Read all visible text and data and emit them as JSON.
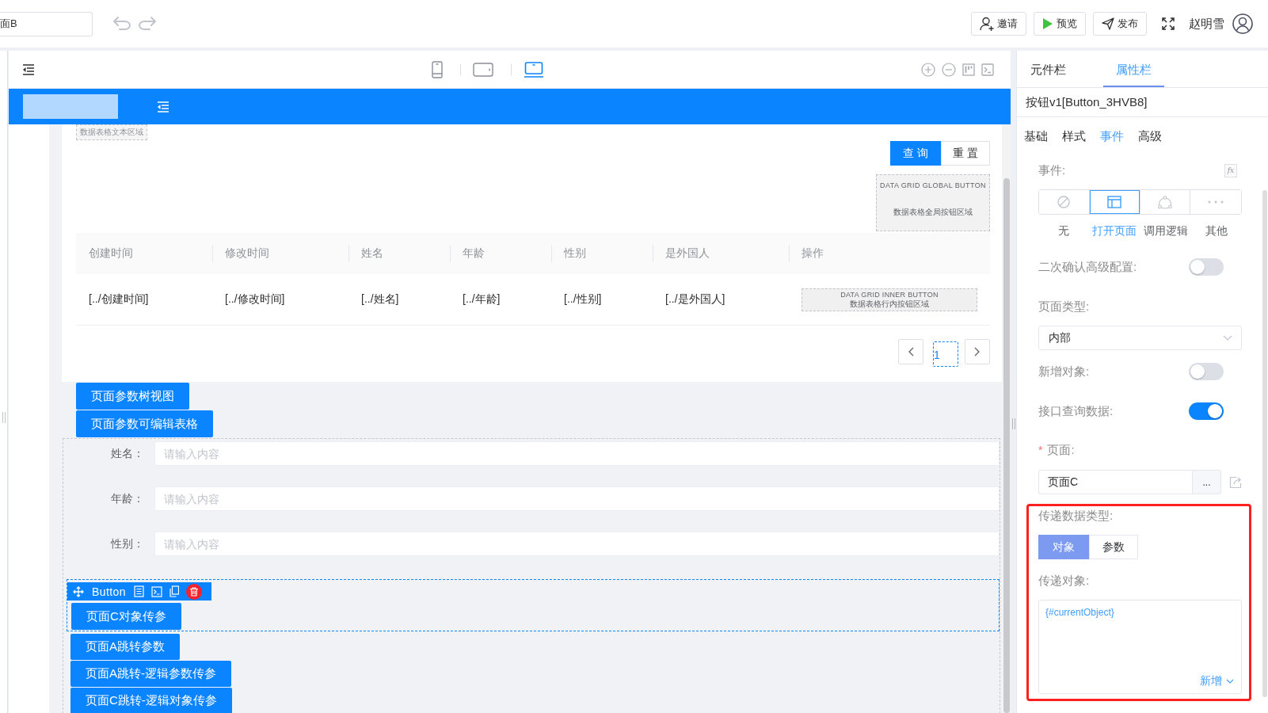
{
  "top_bar": {
    "page_name": "面B",
    "actions": [
      {
        "kind": "invite",
        "label": "邀请"
      },
      {
        "kind": "preview",
        "label": "预览"
      },
      {
        "kind": "publish",
        "label": "发布"
      }
    ],
    "user_name": "赵明雪"
  },
  "canvas": {
    "devices": [
      {
        "kind": "phone",
        "selected": false
      },
      {
        "kind": "tablet",
        "selected": false
      },
      {
        "kind": "laptop",
        "selected": true
      }
    ],
    "grid": {
      "text_area": "数据表格文本区域",
      "query_buttons": [
        {
          "label": "查 询",
          "primary": true
        },
        {
          "label": "重 置",
          "primary": false
        }
      ],
      "global_area": {
        "title": "DATA GRID GLOBAL BUTTON",
        "caption": "数据表格全局按钮区域"
      },
      "columns": [
        "创建时间",
        "修改时间",
        "姓名",
        "年龄",
        "性别",
        "是外国人",
        "操作"
      ],
      "rows": [
        {
          "cells": [
            "[../创建时间]",
            "[../修改时间]",
            "[../姓名]",
            "[../年龄]",
            "[../性别]",
            "[../是外国人]"
          ],
          "inner_area": {
            "title": "DATA GRID INNER BUTTON",
            "caption": "数据表格行内按钮区域"
          }
        }
      ],
      "pages": [
        {
          "label": "1",
          "selected": true
        }
      ]
    },
    "page_buttons": [
      "页面参数树视图",
      "页面参数可编辑表格"
    ],
    "form_fields": [
      {
        "label": "姓名：",
        "placeholder": "请输入内容"
      },
      {
        "label": "年龄：",
        "placeholder": "请输入内容"
      },
      {
        "label": "性别：",
        "placeholder": "请输入内容"
      }
    ],
    "selected_component": {
      "type_label": "Button",
      "label": "页面C对象传参"
    },
    "more_buttons": [
      "页面A跳转参数",
      "页面A跳转-逻辑参数传参",
      "页面C跳转-逻辑对象传参"
    ]
  },
  "panel": {
    "tabs": [
      {
        "label": "元件栏",
        "selected": false
      },
      {
        "label": "属性栏",
        "selected": true
      }
    ],
    "component_title": "按钮v1[Button_3HVB8]",
    "subtabs": [
      {
        "label": "基础",
        "selected": false
      },
      {
        "label": "样式",
        "selected": false
      },
      {
        "label": "事件",
        "selected": true
      },
      {
        "label": "高级",
        "selected": false
      }
    ],
    "event_label": "事件:",
    "formula_button": "fx",
    "event_types": [
      {
        "kind": "none",
        "label": "无",
        "selected": false
      },
      {
        "kind": "open_page",
        "label": "打开页面",
        "selected": true
      },
      {
        "kind": "call_logic",
        "label": "调用逻辑",
        "selected": false
      },
      {
        "kind": "other",
        "label": "其他",
        "selected": false
      }
    ],
    "settings": [
      {
        "kind": "toggle",
        "label": "二次确认高级配置:",
        "on": false
      },
      {
        "kind": "select",
        "label": "页面类型:",
        "value": "内部"
      },
      {
        "kind": "toggle",
        "label": "新增对象:",
        "on": false
      },
      {
        "kind": "toggle",
        "label": "接口查询数据:",
        "on": true
      },
      {
        "kind": "picker",
        "required_mark": "*",
        "label": "页面:",
        "value": "页面C",
        "button": "..."
      }
    ],
    "pass_data": {
      "highlighted": true,
      "type_label": "传递数据类型:",
      "types": [
        {
          "label": "对象",
          "selected": true
        },
        {
          "label": "参数",
          "selected": false
        }
      ],
      "object_label": "传递对象:",
      "object_value": "{#currentObject}",
      "add_label": "新增"
    }
  }
}
